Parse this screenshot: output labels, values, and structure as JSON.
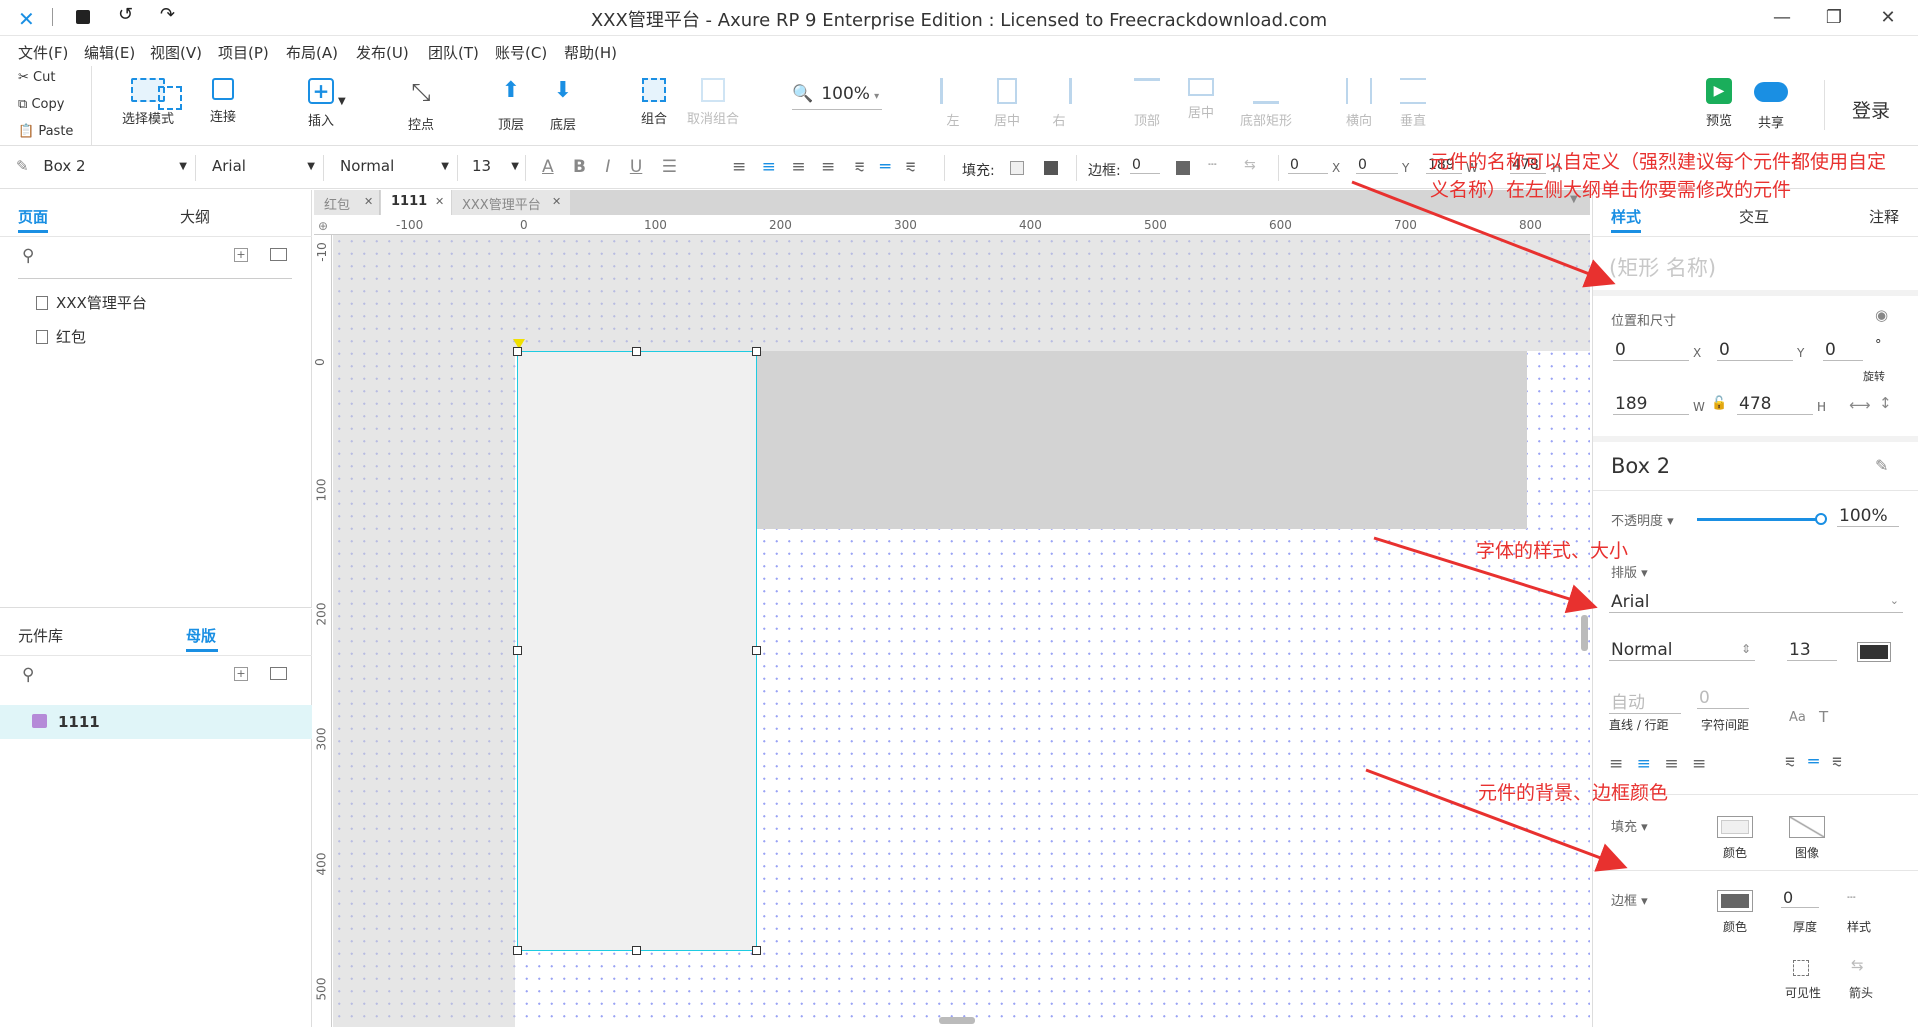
{
  "window": {
    "title": "XXX管理平台 - Axure RP 9 Enterprise Edition : Licensed to Freecrackdownload.com",
    "min": "—",
    "max": "❐",
    "close": "✕"
  },
  "menu": [
    "文件(F)",
    "编辑(E)",
    "视图(V)",
    "项目(P)",
    "布局(A)",
    "发布(U)",
    "团队(T)",
    "账号(C)",
    "帮助(H)"
  ],
  "clipboard": {
    "cut": "Cut",
    "copy": "Copy",
    "paste": "Paste"
  },
  "toolbar": {
    "select_mode": "选择模式",
    "connect": "连接",
    "insert": "插入",
    "point": "控点",
    "top": "顶层",
    "bottom": "底层",
    "group": "组合",
    "ungroup": "取消组合",
    "zoom": "100%",
    "left": "左",
    "center": "居中",
    "right": "右",
    "top_align": "顶部",
    "middle": "居中",
    "bottom_align": "底部矩形",
    "horizontal": "横向",
    "vertical": "垂直",
    "preview": "预览",
    "share": "共享",
    "login": "登录"
  },
  "format": {
    "element": "Box 2",
    "font": "Arial",
    "weight": "Normal",
    "size": "13",
    "fill_label": "填充:",
    "border_label": "边框:",
    "border_value": "0",
    "x": "0",
    "x_lbl": "X",
    "y": "0",
    "y_lbl": "Y",
    "w": "189",
    "w_lbl": "W",
    "h": "478",
    "h_lbl": "H"
  },
  "pages_panel": {
    "tab_pages": "页面",
    "tab_outline": "大纲",
    "pages": [
      "XXX管理平台",
      "红包"
    ]
  },
  "library_panel": {
    "tab_library": "元件库",
    "tab_masters": "母版",
    "masters": [
      "1111"
    ]
  },
  "doc_tabs": [
    {
      "label": "红包"
    },
    {
      "label": "1111"
    },
    {
      "label": "XXX管理平台"
    }
  ],
  "ruler": {
    "h": [
      "-100",
      "0",
      "100",
      "200",
      "300",
      "400",
      "500",
      "600",
      "700",
      "800"
    ],
    "v": [
      "-10",
      "0",
      "100",
      "200",
      "300",
      "400",
      "500"
    ]
  },
  "right_panel": {
    "tab_style": "样式",
    "tab_interact": "交互",
    "tab_notes": "注释",
    "name_placeholder": "(矩形 名称)",
    "pos_size_label": "位置和尺寸",
    "x": "0",
    "x_lbl": "X",
    "y": "0",
    "y_lbl": "Y",
    "rotation": "0",
    "rotation_unit": "°",
    "rotation_lbl": "旋转",
    "w": "189",
    "w_lbl": "W",
    "h": "478",
    "h_lbl": "H",
    "element_name": "Box 2",
    "opacity_label": "不透明度 ▾",
    "opacity_value": "100%",
    "opacity": 1.0,
    "typography_label": "排版 ▾",
    "font": "Arial",
    "weight": "Normal",
    "size": "13",
    "line_height_placeholder": "自动",
    "line_height_lbl": "直线 / 行距",
    "char_spacing": "0",
    "char_spacing_lbl": "字符间距",
    "fill_label": "填充 ▾",
    "fill_color_lbl": "颜色",
    "fill_image_lbl": "图像",
    "border_label": "边框 ▾",
    "border_color_lbl": "颜色",
    "border_thickness": "0",
    "border_thickness_lbl": "厚度",
    "border_style_lbl": "样式",
    "visibility_lbl": "可见性",
    "arrow_lbl": "箭头"
  },
  "annotations": {
    "a1": "元件的名称可以自定义（强烈建议每个元件都使用自定义名称）在左侧大纲单击你要需修改的元件",
    "a2": "字体的样式、大小",
    "a3": "元件的背景、边框颜色"
  },
  "colors": {
    "accent": "#1a8fe3",
    "annotation": "#e8312f",
    "selection": "#1ecbe1",
    "box_fill": "#f0f0f0",
    "gray_area": "#d3d3d3"
  }
}
